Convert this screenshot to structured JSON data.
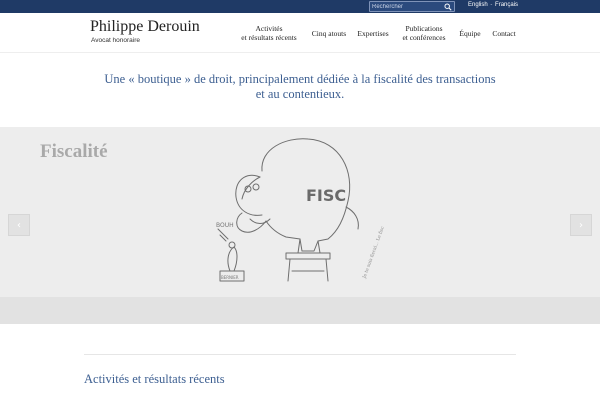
{
  "topbar": {
    "search_placeholder": "Rechercher",
    "lang_english": "English",
    "lang_separator": "-",
    "lang_french": "Français",
    "icons": {
      "search": "search-icon"
    },
    "colors": {
      "bar": "#1f3a66"
    }
  },
  "header": {
    "brand_name": "Philippe Derouin",
    "brand_sub": "Avocat honoraire",
    "nav": {
      "activites_line1": "Activités",
      "activites_line2": "et résultats récents",
      "cinq_atouts": "Cinq atouts",
      "expertises": "Expertises",
      "publications_line1": "Publications",
      "publications_line2": "et conférences",
      "equipe": "Équipe",
      "contact": "Contact"
    }
  },
  "tagline": {
    "line1": "Une « boutique » de droit, principalement dédiée à la fiscalité des transactions",
    "line2": "et au contentieux."
  },
  "slider": {
    "title": "Fiscalité",
    "prev_icon": "chevron-left-icon",
    "next_icon": "chevron-right-icon",
    "prev_glyph": "‹",
    "next_glyph": "›",
    "illustration": {
      "elephant_label": "FISC",
      "mouse_label": "BOUH",
      "box_label": "BERNIER",
      "signature": "Je te suis fiscal... Le fisc"
    }
  },
  "section": {
    "heading": "Activités et résultats récents"
  }
}
